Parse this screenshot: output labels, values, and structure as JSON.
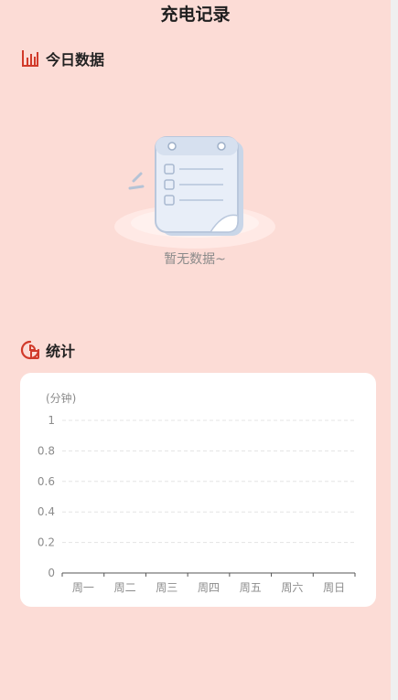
{
  "header": {
    "title": "充电记录"
  },
  "today_section": {
    "title": "今日数据",
    "icon": "bar-chart-icon",
    "empty_text": "暂无数据~"
  },
  "stats_section": {
    "title": "统计",
    "icon": "stats-ring-icon"
  },
  "colors": {
    "accent": "#d13a2a",
    "background": "#fcdcd6",
    "card": "#ffffff"
  },
  "chart_data": {
    "type": "line",
    "unit_label": "(分钟)",
    "categories": [
      "周一",
      "周二",
      "周三",
      "周四",
      "周五",
      "周六",
      "周日"
    ],
    "y_ticks": [
      "0",
      "0.2",
      "0.4",
      "0.6",
      "0.8",
      "1"
    ],
    "ylim": [
      0,
      1
    ],
    "series": [],
    "grid": true
  }
}
